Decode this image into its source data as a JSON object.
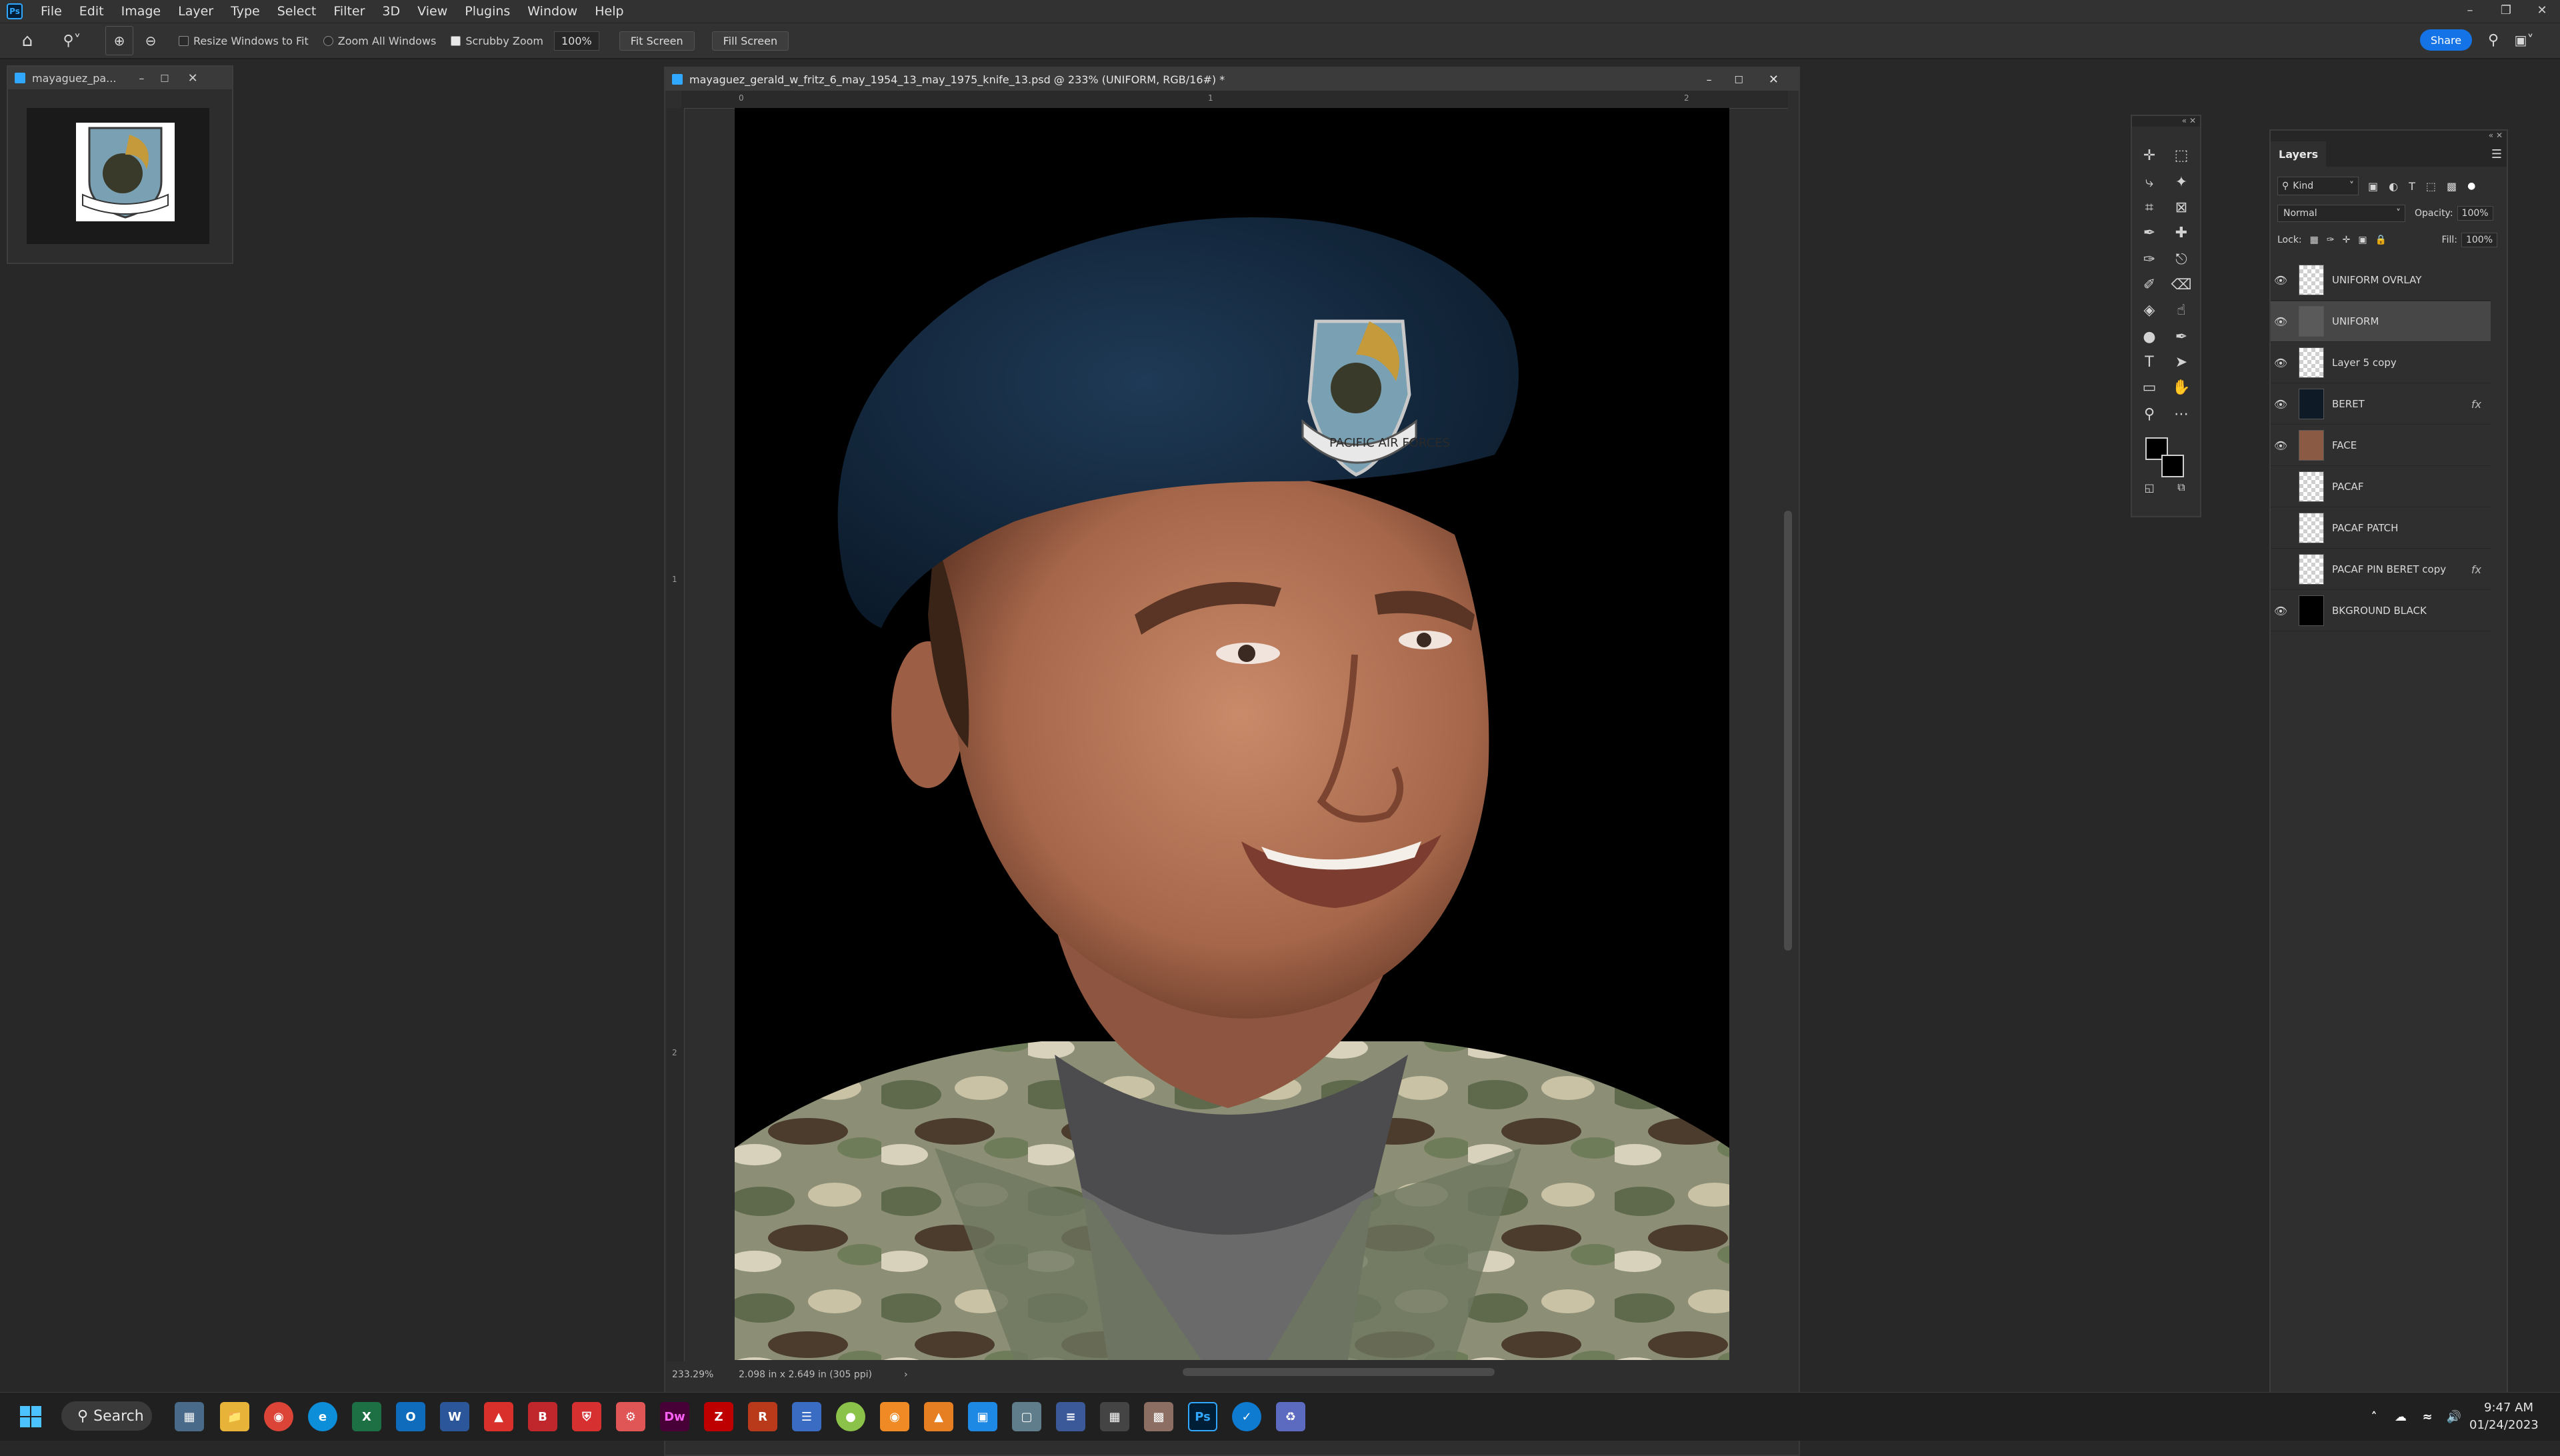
{
  "menu": {
    "app_badge": "Ps",
    "items": [
      "File",
      "Edit",
      "Image",
      "Layer",
      "Type",
      "Select",
      "Filter",
      "3D",
      "View",
      "Plugins",
      "Window",
      "Help"
    ]
  },
  "options_bar": {
    "resize_windows": "Resize Windows to Fit",
    "zoom_all": "Zoom All Windows",
    "scrubby_zoom": "Scrubby Zoom",
    "zoom_value": "100%",
    "fit_screen": "Fit Screen",
    "fill_screen": "Fill Screen",
    "share": "Share"
  },
  "navigator_doc": {
    "title": "mayaguez_pa..."
  },
  "document": {
    "title": "mayaguez_gerald_w_fritz_6_may_1954_13_may_1975_knife_13.psd @ 233% (UNIFORM, RGB/16#) *",
    "status_zoom": "233.29%",
    "status_info": "2.098 in x 2.649 in (305 ppi)",
    "ruler_h": [
      "0",
      "1",
      "2"
    ],
    "ruler_v": [
      "1",
      "2"
    ],
    "badge_text": "PACIFIC AIR FORCES"
  },
  "layers_panel": {
    "tab": "Layers",
    "filter_kind": "Kind",
    "blend_mode": "Normal",
    "opacity_label": "Opacity:",
    "opacity_value": "100%",
    "lock_label": "Lock:",
    "fill_label": "Fill:",
    "fill_value": "100%",
    "layers": [
      {
        "name": "UNIFORM OVRLAY",
        "visible": true,
        "fx": ""
      },
      {
        "name": "UNIFORM",
        "visible": true,
        "fx": "",
        "selected": true
      },
      {
        "name": "Layer 5 copy",
        "visible": true,
        "fx": ""
      },
      {
        "name": "BERET",
        "visible": true,
        "fx": "fx"
      },
      {
        "name": "FACE",
        "visible": true,
        "fx": ""
      },
      {
        "name": "PACAF",
        "visible": false,
        "fx": ""
      },
      {
        "name": "PACAF PATCH",
        "visible": false,
        "fx": ""
      },
      {
        "name": "PACAF PIN BERET copy",
        "visible": false,
        "fx": "fx"
      },
      {
        "name": "BKGROUND BLACK",
        "visible": true,
        "fx": ""
      }
    ]
  },
  "taskbar": {
    "search": "Search",
    "time": "9:47 AM",
    "date": "01/24/2023",
    "icons": [
      "B",
      "Dw",
      "Ps"
    ]
  }
}
